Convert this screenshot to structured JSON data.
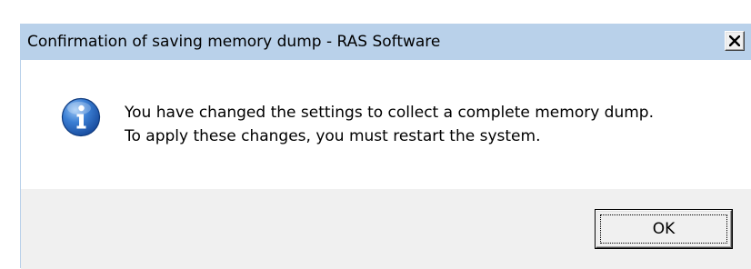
{
  "window": {
    "title": "Confirmation of saving memory dump - RAS Software",
    "close_icon": "close-icon",
    "titlebar_color": "#b9d1ea",
    "footer_color": "#f0f0f0"
  },
  "message": {
    "icon": "info-icon",
    "icon_color": "#1f5fb0",
    "line1": "You have changed the settings to collect a complete memory dump.",
    "line2": "To apply these changes, you must restart the system."
  },
  "buttons": {
    "ok_label": "OK"
  }
}
